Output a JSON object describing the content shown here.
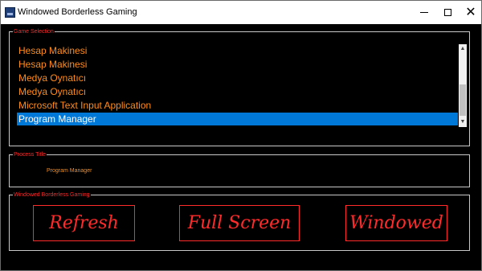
{
  "window": {
    "title": "Windowed Borderless Gaming",
    "controls": {
      "minimize": "minimize",
      "maximize": "maximize",
      "close": "✕"
    }
  },
  "game_selection": {
    "label": "Game Selection",
    "items": [
      "Hesap Makinesi",
      "Hesap Makinesi",
      "Medya Oynatıcı",
      "Medya Oynatıcı",
      "Microsoft Text Input Application",
      "Program Manager"
    ],
    "selected_index": 5
  },
  "process_title": {
    "label": "Process Title",
    "value": "Program Manager"
  },
  "actions": {
    "label": "Windowed Borderless Gaming",
    "refresh": "Refresh",
    "full_screen": "Full Screen",
    "windowed": "Windowed"
  },
  "colors": {
    "accent_red": "#ff2a2a",
    "item_orange": "#ff8c1a",
    "selection_blue": "#0078d7",
    "background": "#000000"
  },
  "icons": {
    "app": "app-icon",
    "scroll_up": "chevron-up-icon",
    "scroll_down": "chevron-down-icon"
  }
}
